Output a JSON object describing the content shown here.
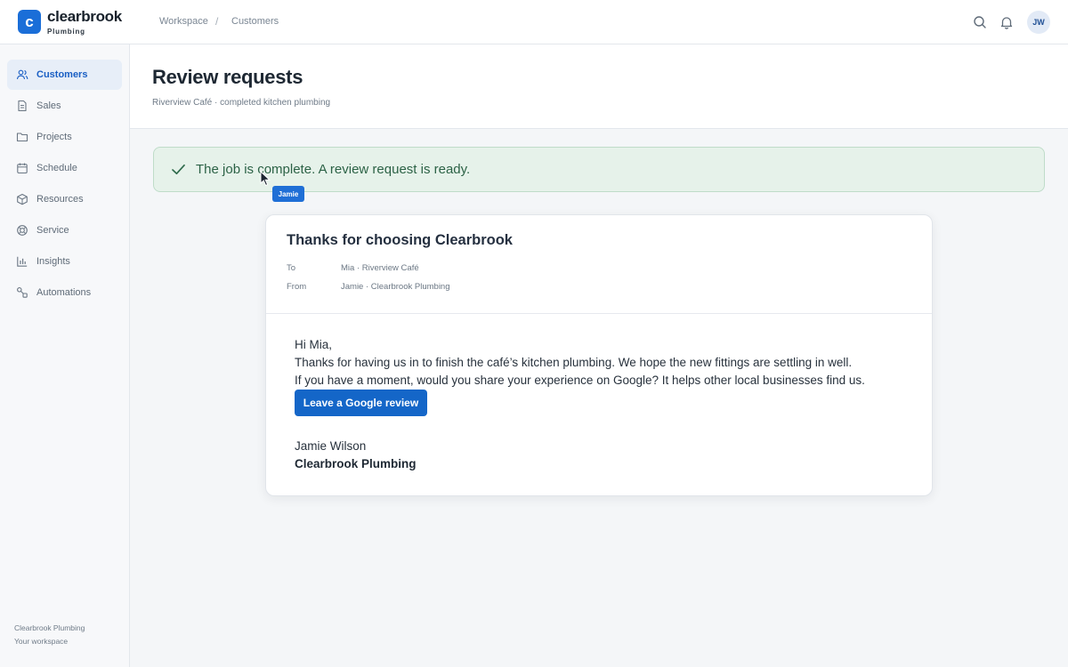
{
  "brand": {
    "mark": "c",
    "name": "clearbrook",
    "tagline": "Plumbing"
  },
  "breadcrumb": {
    "items": [
      "Workspace",
      "Customers"
    ],
    "separator": "/"
  },
  "header_icons": [
    "search-icon",
    "bell-icon"
  ],
  "user": {
    "initials": "JW"
  },
  "sidebar": {
    "items": [
      {
        "label": "Customers",
        "icon": "users-icon",
        "active": true
      },
      {
        "label": "Sales",
        "icon": "document-icon",
        "active": false
      },
      {
        "label": "Projects",
        "icon": "folder-icon",
        "active": false
      },
      {
        "label": "Schedule",
        "icon": "calendar-icon",
        "active": false
      },
      {
        "label": "Resources",
        "icon": "box-icon",
        "active": false
      },
      {
        "label": "Service",
        "icon": "lifebuoy-icon",
        "active": false
      },
      {
        "label": "Insights",
        "icon": "bar-chart-icon",
        "active": false
      },
      {
        "label": "Automations",
        "icon": "workflow-icon",
        "active": false
      }
    ],
    "footer": {
      "company": "Clearbrook Plumbing",
      "caption": "Your workspace"
    }
  },
  "page": {
    "title": "Review requests",
    "subtitle": "Riverview Café · completed kitchen plumbing"
  },
  "banner": {
    "text": "The job is complete. A review request is ready.",
    "color": "#e6f2ea"
  },
  "cursor": {
    "label": "Jamie"
  },
  "email": {
    "subject": "Thanks for choosing Clearbrook",
    "to_label": "To",
    "to_value": "Mia · Riverview Café",
    "from_label": "From",
    "from_value": "Jamie · Clearbrook Plumbing",
    "greeting": "Hi Mia,",
    "line1": "Thanks for having us in to finish the café’s kitchen plumbing. We hope the new fittings are settling in well.",
    "line2": "If you have a moment, would you share your experience on Google? It helps other local businesses find us.",
    "cta_label": "Leave a Google review",
    "signature_name": "Jamie Wilson",
    "signature_company": "Clearbrook Plumbing"
  },
  "colors": {
    "accent": "#1466c8",
    "success_bg": "#e6f2ea",
    "success_text": "#2c6246"
  }
}
